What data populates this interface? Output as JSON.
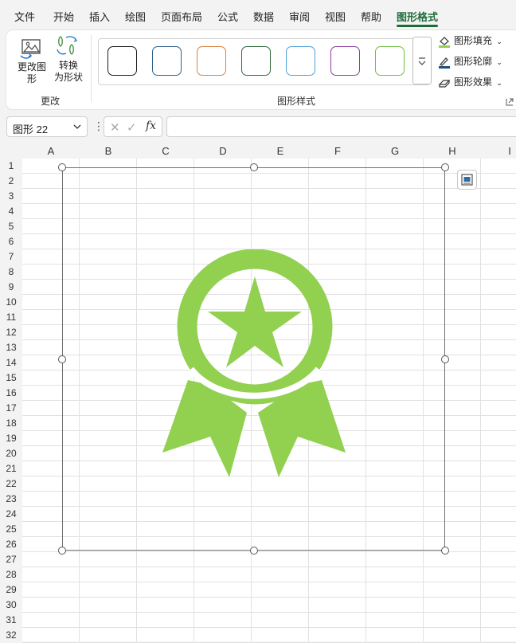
{
  "menu": {
    "tabs": [
      "文件",
      "开始",
      "插入",
      "绘图",
      "页面布局",
      "公式",
      "数据",
      "审阅",
      "视图",
      "帮助",
      "图形格式"
    ],
    "active_tab": "图形格式"
  },
  "ribbon": {
    "change_group": {
      "change_shape_label": "更改图形",
      "convert_label_line1": "转换",
      "convert_label_line2": "为形状",
      "group_label": "更改"
    },
    "styles_group": {
      "swatch_colors": [
        "#1a1a1a",
        "#2e5f8a",
        "#d9823b",
        "#2e6b3a",
        "#4aa3d6",
        "#8b3c9e",
        "#6fbe45"
      ],
      "group_label": "图形样式"
    },
    "fill_label": "图形填充",
    "outline_label": "图形轮廓",
    "effects_label": "图形效果"
  },
  "formula_bar": {
    "name_box": "图形 22",
    "formula": ""
  },
  "grid": {
    "columns": [
      "A",
      "B",
      "C",
      "D",
      "E",
      "F",
      "G",
      "H",
      "I"
    ],
    "rows": [
      "1",
      "2",
      "3",
      "4",
      "5",
      "6",
      "7",
      "8",
      "9",
      "10",
      "11",
      "12",
      "13",
      "14",
      "15",
      "16",
      "17",
      "18",
      "19",
      "20",
      "21",
      "22",
      "23",
      "24",
      "25",
      "26",
      "27",
      "28",
      "29",
      "30",
      "31",
      "32"
    ]
  },
  "shape": {
    "icon": "award-ribbon-icon",
    "color": "#92d050"
  },
  "colors": {
    "accent": "#1e6b3a",
    "icon_green": "#92d050"
  }
}
